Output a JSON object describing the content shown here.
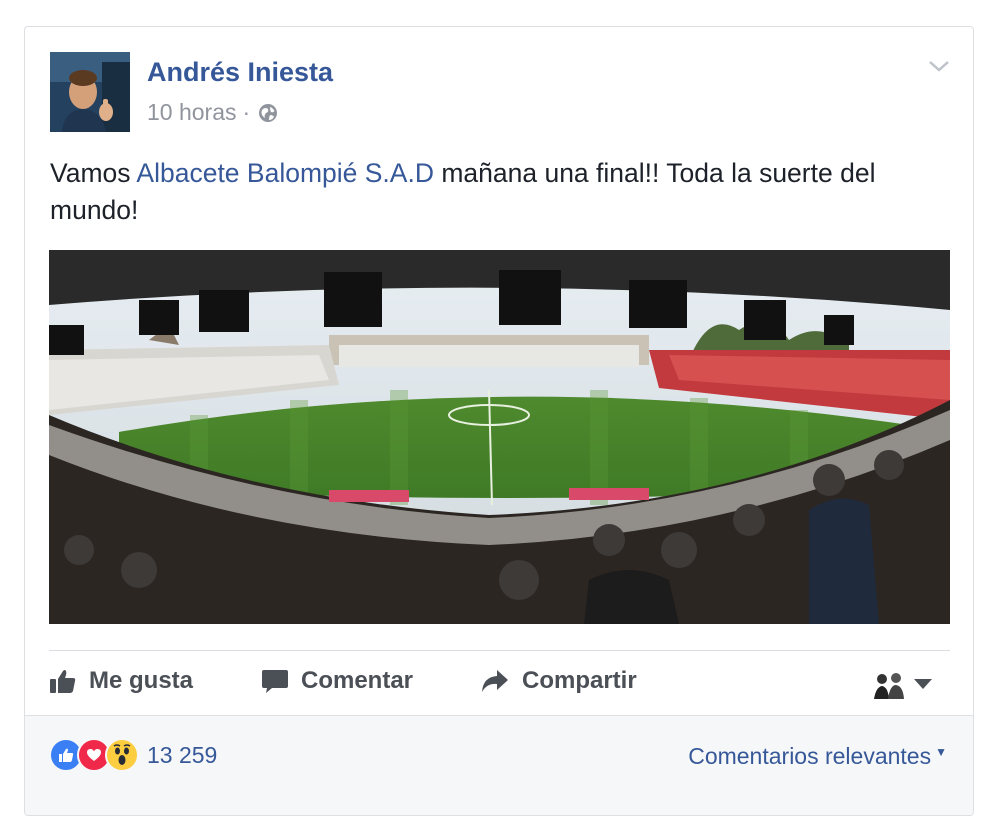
{
  "post": {
    "author": "Andrés Iniesta",
    "time": "10 horas",
    "dot": "·",
    "text_before": "Vamos ",
    "mention": "Albacete Balompié S.A.D",
    "text_after": " mañana una final!! Toda la suerte del mundo!"
  },
  "actions": {
    "like": "Me gusta",
    "comment": "Comentar",
    "share": "Compartir"
  },
  "reactions": {
    "types": [
      "like-reaction",
      "love-reaction",
      "wow-reaction"
    ],
    "count": "13 259"
  },
  "comments_filter": "Comentarios relevantes",
  "icons": {
    "globe": "globe-icon",
    "chevron": "chevron-down-icon",
    "like": "thumbs-up-icon",
    "comment": "speech-bubble-icon",
    "share": "share-arrow-icon"
  },
  "colors": {
    "link": "#365899",
    "text": "#1d2129",
    "muted": "#90949c",
    "action": "#4b4f56",
    "like_blue": "#3b7ff5",
    "love_red": "#f0284a",
    "wow_yellow": "#fbcd3f"
  }
}
